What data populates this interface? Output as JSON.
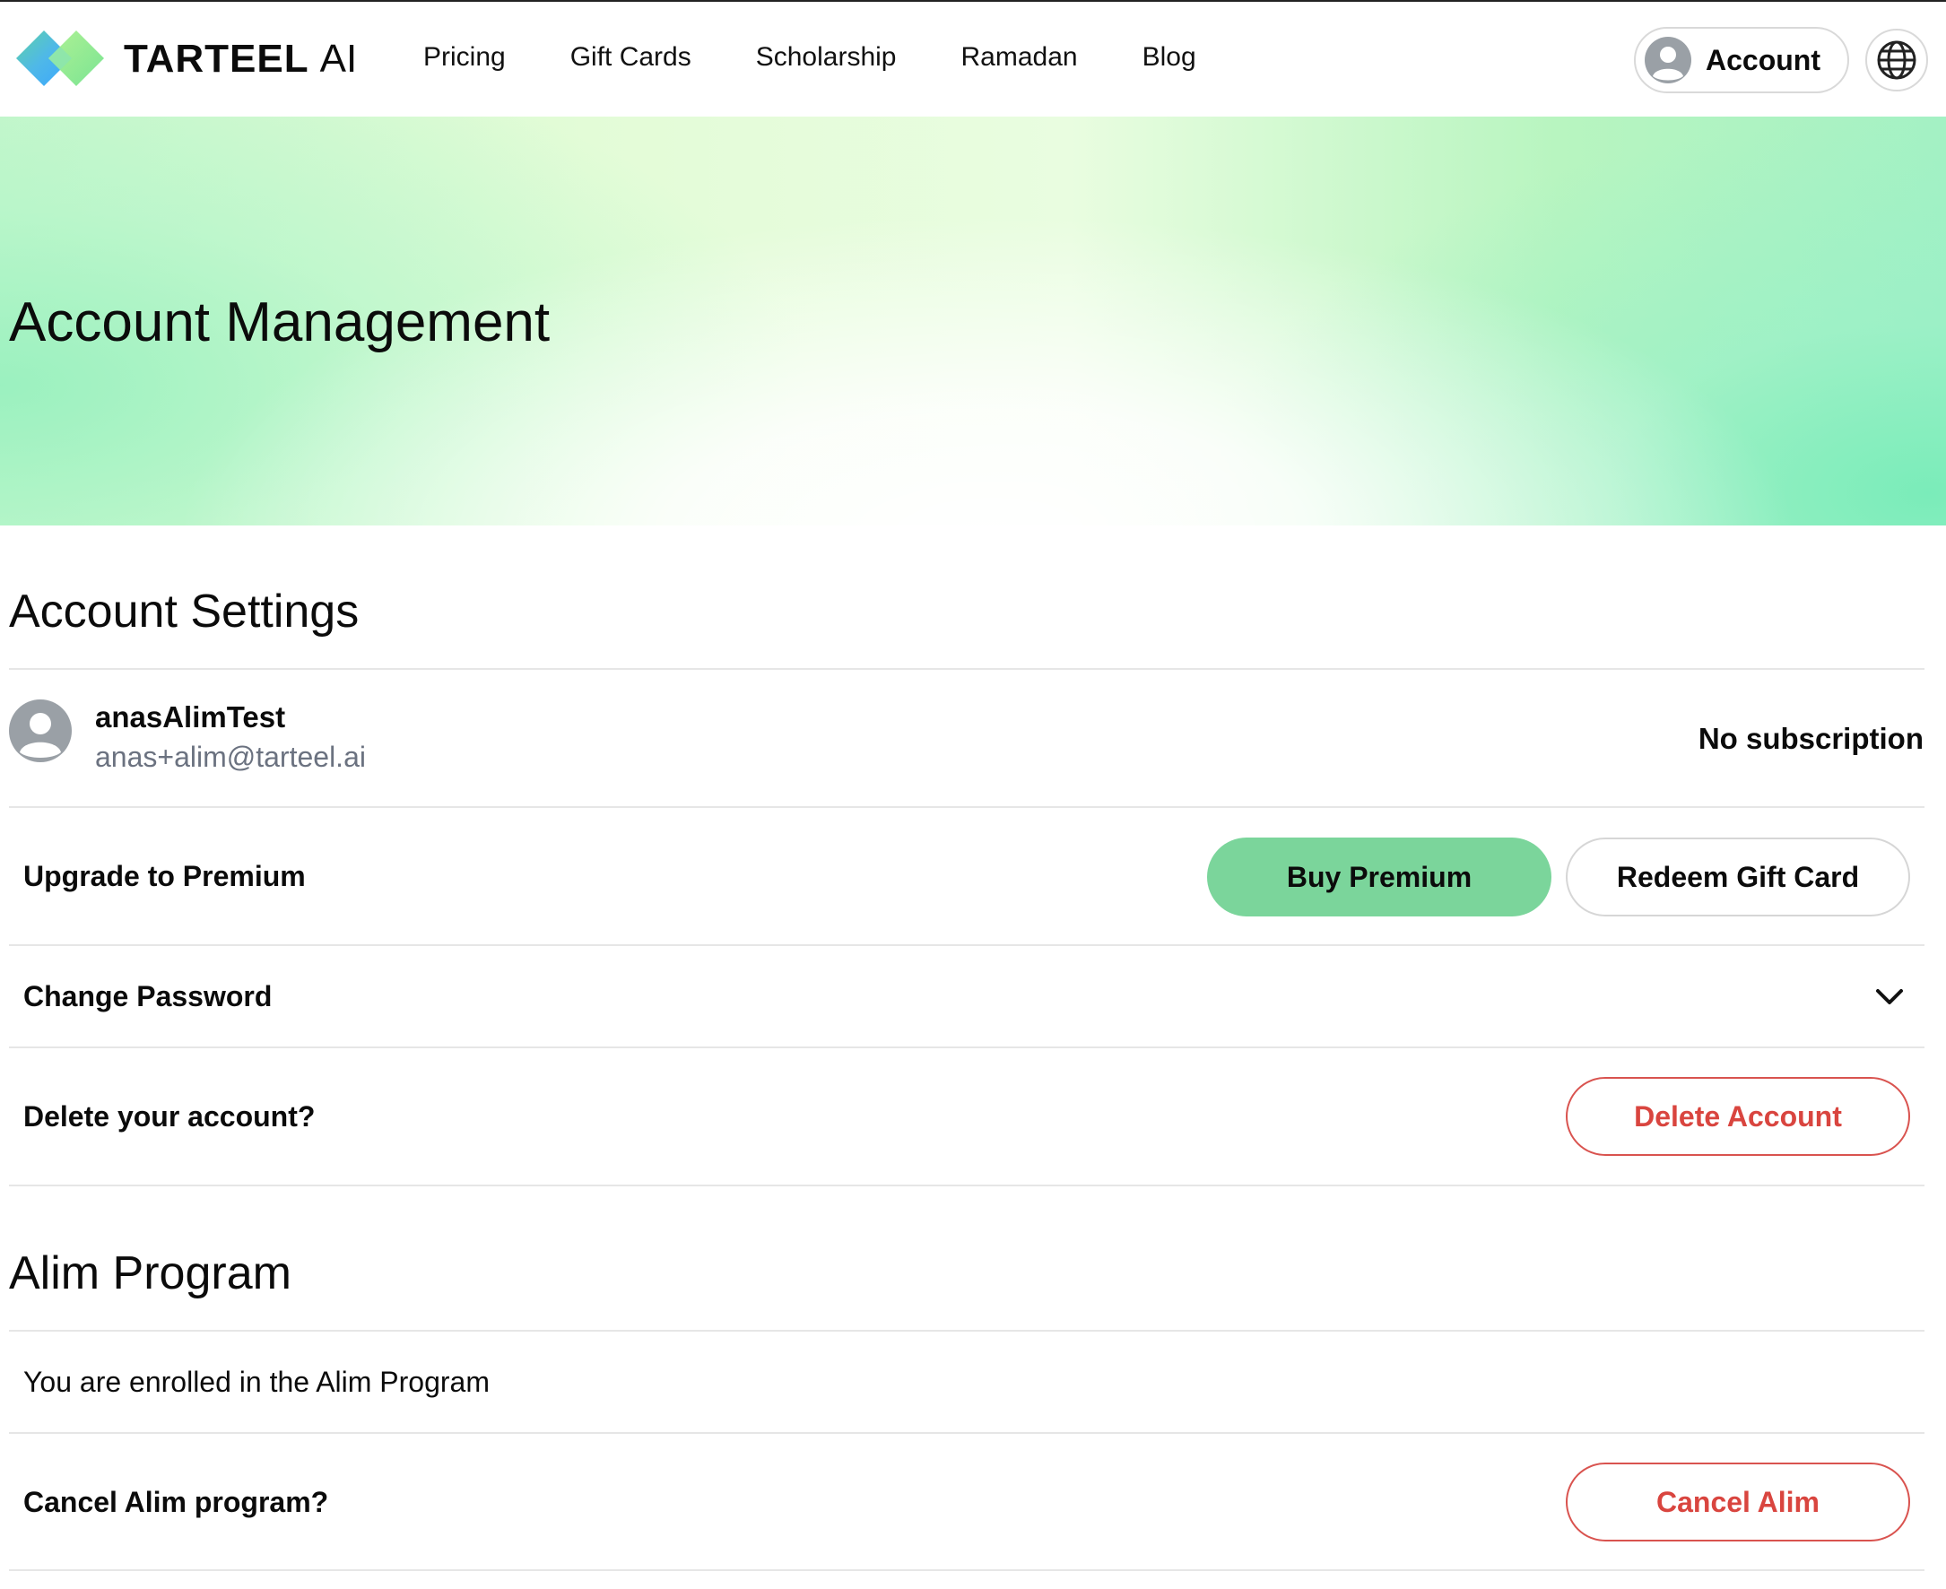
{
  "header": {
    "brand_main": "TARTEEL",
    "brand_ai": "AI",
    "nav": [
      {
        "label": "Pricing"
      },
      {
        "label": "Gift Cards"
      },
      {
        "label": "Scholarship"
      },
      {
        "label": "Ramadan"
      },
      {
        "label": "Blog"
      }
    ],
    "account_label": "Account",
    "icons": {
      "account": "user-avatar-icon",
      "language": "globe-icon"
    }
  },
  "hero": {
    "title": "Account Management"
  },
  "settings": {
    "title": "Account Settings",
    "user": {
      "name": "anasAlimTest",
      "email": "anas+alim@tarteel.ai"
    },
    "subscription_status": "No subscription",
    "upgrade": {
      "label": "Upgrade to Premium",
      "buy_button": "Buy Premium",
      "redeem_button": "Redeem Gift Card"
    },
    "password": {
      "label": "Change Password",
      "icon": "chevron-down-icon"
    },
    "delete": {
      "label": "Delete your account?",
      "button": "Delete Account"
    }
  },
  "alim": {
    "title": "Alim Program",
    "status": "You are enrolled in the Alim Program",
    "cancel": {
      "label": "Cancel Alim program?",
      "button": "Cancel Alim"
    }
  },
  "colors": {
    "accent_green": "#7bd59b",
    "danger_red": "#d9453f",
    "muted_text": "#6b7280",
    "divider": "#e6e6e6"
  }
}
